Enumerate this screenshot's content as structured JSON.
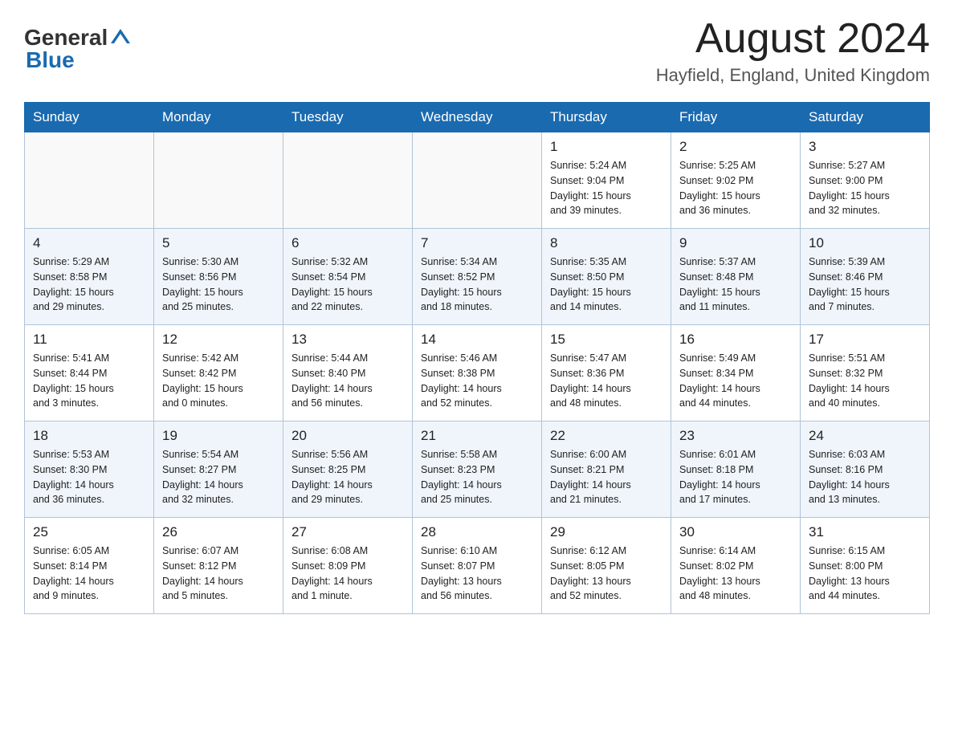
{
  "header": {
    "logo_general": "General",
    "logo_blue": "Blue",
    "month_year": "August 2024",
    "location": "Hayfield, England, United Kingdom"
  },
  "days_of_week": [
    "Sunday",
    "Monday",
    "Tuesday",
    "Wednesday",
    "Thursday",
    "Friday",
    "Saturday"
  ],
  "weeks": [
    {
      "days": [
        {
          "number": "",
          "info": ""
        },
        {
          "number": "",
          "info": ""
        },
        {
          "number": "",
          "info": ""
        },
        {
          "number": "",
          "info": ""
        },
        {
          "number": "1",
          "info": "Sunrise: 5:24 AM\nSunset: 9:04 PM\nDaylight: 15 hours\nand 39 minutes."
        },
        {
          "number": "2",
          "info": "Sunrise: 5:25 AM\nSunset: 9:02 PM\nDaylight: 15 hours\nand 36 minutes."
        },
        {
          "number": "3",
          "info": "Sunrise: 5:27 AM\nSunset: 9:00 PM\nDaylight: 15 hours\nand 32 minutes."
        }
      ]
    },
    {
      "days": [
        {
          "number": "4",
          "info": "Sunrise: 5:29 AM\nSunset: 8:58 PM\nDaylight: 15 hours\nand 29 minutes."
        },
        {
          "number": "5",
          "info": "Sunrise: 5:30 AM\nSunset: 8:56 PM\nDaylight: 15 hours\nand 25 minutes."
        },
        {
          "number": "6",
          "info": "Sunrise: 5:32 AM\nSunset: 8:54 PM\nDaylight: 15 hours\nand 22 minutes."
        },
        {
          "number": "7",
          "info": "Sunrise: 5:34 AM\nSunset: 8:52 PM\nDaylight: 15 hours\nand 18 minutes."
        },
        {
          "number": "8",
          "info": "Sunrise: 5:35 AM\nSunset: 8:50 PM\nDaylight: 15 hours\nand 14 minutes."
        },
        {
          "number": "9",
          "info": "Sunrise: 5:37 AM\nSunset: 8:48 PM\nDaylight: 15 hours\nand 11 minutes."
        },
        {
          "number": "10",
          "info": "Sunrise: 5:39 AM\nSunset: 8:46 PM\nDaylight: 15 hours\nand 7 minutes."
        }
      ]
    },
    {
      "days": [
        {
          "number": "11",
          "info": "Sunrise: 5:41 AM\nSunset: 8:44 PM\nDaylight: 15 hours\nand 3 minutes."
        },
        {
          "number": "12",
          "info": "Sunrise: 5:42 AM\nSunset: 8:42 PM\nDaylight: 15 hours\nand 0 minutes."
        },
        {
          "number": "13",
          "info": "Sunrise: 5:44 AM\nSunset: 8:40 PM\nDaylight: 14 hours\nand 56 minutes."
        },
        {
          "number": "14",
          "info": "Sunrise: 5:46 AM\nSunset: 8:38 PM\nDaylight: 14 hours\nand 52 minutes."
        },
        {
          "number": "15",
          "info": "Sunrise: 5:47 AM\nSunset: 8:36 PM\nDaylight: 14 hours\nand 48 minutes."
        },
        {
          "number": "16",
          "info": "Sunrise: 5:49 AM\nSunset: 8:34 PM\nDaylight: 14 hours\nand 44 minutes."
        },
        {
          "number": "17",
          "info": "Sunrise: 5:51 AM\nSunset: 8:32 PM\nDaylight: 14 hours\nand 40 minutes."
        }
      ]
    },
    {
      "days": [
        {
          "number": "18",
          "info": "Sunrise: 5:53 AM\nSunset: 8:30 PM\nDaylight: 14 hours\nand 36 minutes."
        },
        {
          "number": "19",
          "info": "Sunrise: 5:54 AM\nSunset: 8:27 PM\nDaylight: 14 hours\nand 32 minutes."
        },
        {
          "number": "20",
          "info": "Sunrise: 5:56 AM\nSunset: 8:25 PM\nDaylight: 14 hours\nand 29 minutes."
        },
        {
          "number": "21",
          "info": "Sunrise: 5:58 AM\nSunset: 8:23 PM\nDaylight: 14 hours\nand 25 minutes."
        },
        {
          "number": "22",
          "info": "Sunrise: 6:00 AM\nSunset: 8:21 PM\nDaylight: 14 hours\nand 21 minutes."
        },
        {
          "number": "23",
          "info": "Sunrise: 6:01 AM\nSunset: 8:18 PM\nDaylight: 14 hours\nand 17 minutes."
        },
        {
          "number": "24",
          "info": "Sunrise: 6:03 AM\nSunset: 8:16 PM\nDaylight: 14 hours\nand 13 minutes."
        }
      ]
    },
    {
      "days": [
        {
          "number": "25",
          "info": "Sunrise: 6:05 AM\nSunset: 8:14 PM\nDaylight: 14 hours\nand 9 minutes."
        },
        {
          "number": "26",
          "info": "Sunrise: 6:07 AM\nSunset: 8:12 PM\nDaylight: 14 hours\nand 5 minutes."
        },
        {
          "number": "27",
          "info": "Sunrise: 6:08 AM\nSunset: 8:09 PM\nDaylight: 14 hours\nand 1 minute."
        },
        {
          "number": "28",
          "info": "Sunrise: 6:10 AM\nSunset: 8:07 PM\nDaylight: 13 hours\nand 56 minutes."
        },
        {
          "number": "29",
          "info": "Sunrise: 6:12 AM\nSunset: 8:05 PM\nDaylight: 13 hours\nand 52 minutes."
        },
        {
          "number": "30",
          "info": "Sunrise: 6:14 AM\nSunset: 8:02 PM\nDaylight: 13 hours\nand 48 minutes."
        },
        {
          "number": "31",
          "info": "Sunrise: 6:15 AM\nSunset: 8:00 PM\nDaylight: 13 hours\nand 44 minutes."
        }
      ]
    }
  ]
}
